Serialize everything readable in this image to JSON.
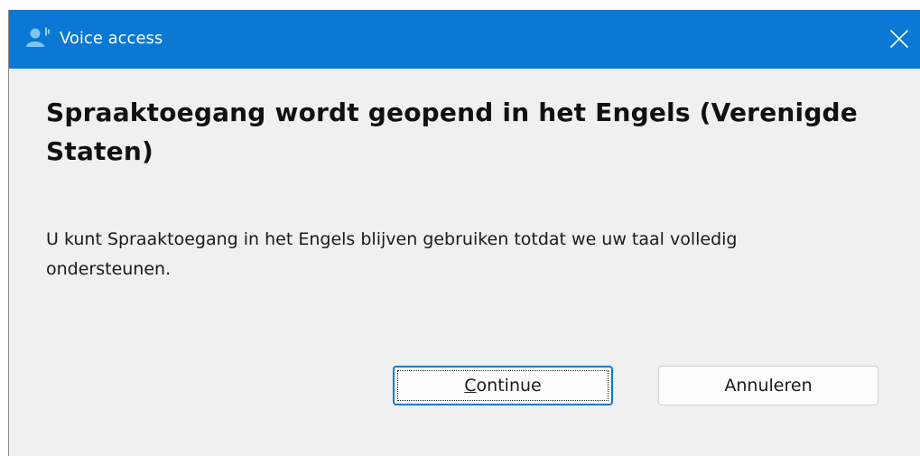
{
  "window": {
    "title": "Voice access",
    "icon": "voice-access-person-icon",
    "close_icon": "close-icon"
  },
  "dialog": {
    "heading": "Spraaktoegang wordt geopend in het Engels (Verenigde Staten)",
    "message": "U kunt Spraaktoegang in het Engels blijven gebruiken totdat we uw taal volledig ondersteunen."
  },
  "buttons": {
    "continue_mnemonic": "C",
    "continue_rest": "ontinue",
    "cancel_label": "Annuleren"
  },
  "colors": {
    "titlebar": "#0a78d4",
    "window_background": "#f0f0f0",
    "default_button_border": "#0a78d4"
  }
}
